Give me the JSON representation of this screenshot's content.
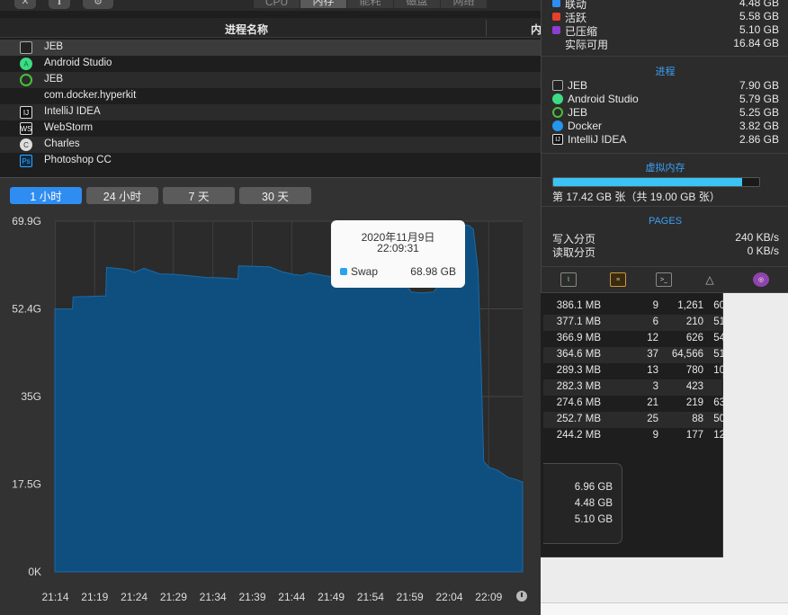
{
  "activity_monitor": {
    "toolbar": {
      "tabs": [
        "CPU",
        "内存",
        "能耗",
        "磁盘",
        "网络"
      ],
      "active_tab": 1
    },
    "columns": {
      "process_name": "进程名称",
      "memory": "内"
    },
    "processes": [
      {
        "name": "JEB",
        "icon": "jeb-icon"
      },
      {
        "name": "Android Studio",
        "icon": "android-studio-icon"
      },
      {
        "name": "JEB",
        "icon": "jeb-green-icon"
      },
      {
        "name": "com.docker.hyperkit",
        "icon": ""
      },
      {
        "name": "IntelliJ IDEA",
        "icon": "intellij-icon"
      },
      {
        "name": "WebStorm",
        "icon": "webstorm-icon"
      },
      {
        "name": "Charles",
        "icon": "charles-icon"
      },
      {
        "name": "Photoshop CC",
        "icon": "photoshop-icon"
      }
    ],
    "stats_rows": [
      {
        "mem": "386.1 MB",
        "threads": "9",
        "ports": "1,261",
        "pid": "60"
      },
      {
        "mem": "377.1 MB",
        "threads": "6",
        "ports": "210",
        "pid": "51"
      },
      {
        "mem": "366.9 MB",
        "threads": "12",
        "ports": "626",
        "pid": "54"
      },
      {
        "mem": "364.6 MB",
        "threads": "37",
        "ports": "64,566",
        "pid": "51"
      },
      {
        "mem": "289.3 MB",
        "threads": "13",
        "ports": "780",
        "pid": "10"
      },
      {
        "mem": "282.3 MB",
        "threads": "3",
        "ports": "423",
        "pid": ""
      },
      {
        "mem": "274.6 MB",
        "threads": "21",
        "ports": "219",
        "pid": "63"
      },
      {
        "mem": "252.7 MB",
        "threads": "25",
        "ports": "88",
        "pid": "50"
      },
      {
        "mem": "244.2 MB",
        "threads": "9",
        "ports": "177",
        "pid": "12"
      }
    ],
    "summary": [
      "6.96 GB",
      "4.48 GB",
      "5.10 GB"
    ]
  },
  "memory_popover": {
    "legend": [
      {
        "label": "联动",
        "value": "4.48 GB",
        "color": "#2f8cf0"
      },
      {
        "label": "活跃",
        "value": "5.58 GB",
        "color": "#e8402e"
      },
      {
        "label": "已压缩",
        "value": "5.10 GB",
        "color": "#8a3fd1"
      },
      {
        "label": "实际可用",
        "value": "16.84 GB",
        "color": ""
      }
    ],
    "processes_title": "进程",
    "apps": [
      {
        "name": "JEB",
        "value": "7.90 GB",
        "icon": "jeb-icon"
      },
      {
        "name": "Android Studio",
        "value": "5.79 GB",
        "icon": "android-studio-icon"
      },
      {
        "name": "JEB",
        "value": "5.25 GB",
        "icon": "jeb-green-icon"
      },
      {
        "name": "Docker",
        "value": "3.82 GB",
        "icon": "docker-icon"
      },
      {
        "name": "IntelliJ IDEA",
        "value": "2.86 GB",
        "icon": "intellij-icon"
      }
    ],
    "vm_title": "虚拟内存",
    "vm_fill": 0.9168,
    "vm_text": "第 17.42 GB 张（共 19.00 GB 张）",
    "pages_title": "PAGES",
    "pages": [
      {
        "label": "写入分页",
        "value": "240 KB/s"
      },
      {
        "label": "读取分页",
        "value": "0 KB/s"
      }
    ],
    "bottom_icons": [
      "activity-icon",
      "console-log-icon",
      "terminal-icon",
      "flask-icon",
      "browser-icon"
    ]
  },
  "chart_window": {
    "ranges": [
      "1 小时",
      "24 小时",
      "7 天",
      "30 天"
    ],
    "active_range": 0,
    "tooltip": {
      "date": "2020年11月9日",
      "time": "22:09:31",
      "series": "Swap",
      "value": "68.98 GB"
    }
  },
  "chart_data": {
    "type": "area",
    "series": [
      {
        "name": "Swap",
        "color": "#0f4f7f",
        "points": [
          [
            0,
            52.4
          ],
          [
            0.5,
            52.4
          ],
          [
            1.1,
            52.4
          ],
          [
            1.15,
            54.8
          ],
          [
            3.2,
            55.0
          ],
          [
            3.25,
            60.7
          ],
          [
            4.5,
            60.3
          ],
          [
            5.0,
            59.7
          ],
          [
            5.6,
            60.5
          ],
          [
            6.6,
            59.4
          ],
          [
            7.5,
            59.3
          ],
          [
            8.5,
            59.0
          ],
          [
            9.5,
            58.7
          ],
          [
            10.5,
            58.6
          ],
          [
            11.5,
            58.4
          ],
          [
            11.55,
            61.0
          ],
          [
            13.5,
            60.8
          ],
          [
            14.3,
            59.8
          ],
          [
            15.0,
            59.3
          ],
          [
            15.5,
            59.1
          ],
          [
            16.0,
            59.6
          ],
          [
            17.0,
            59.0
          ],
          [
            18.0,
            58.6
          ],
          [
            19.0,
            58.5
          ],
          [
            20.0,
            58.2
          ],
          [
            21.0,
            57.8
          ],
          [
            22.0,
            57.4
          ],
          [
            22.4,
            55.8
          ],
          [
            23.0,
            55.6
          ],
          [
            23.8,
            55.8
          ],
          [
            24.2,
            57.5
          ],
          [
            24.8,
            59.0
          ],
          [
            25.0,
            62.0
          ],
          [
            25.15,
            67.5
          ],
          [
            25.3,
            69.2
          ],
          [
            26.0,
            69.1
          ],
          [
            26.3,
            68.3
          ],
          [
            26.6,
            60.0
          ],
          [
            26.8,
            40.0
          ],
          [
            26.95,
            22.0
          ],
          [
            27.3,
            20.8
          ],
          [
            27.8,
            20.3
          ],
          [
            28.5,
            18.8
          ],
          [
            29.0,
            18.4
          ],
          [
            29.4,
            17.9
          ]
        ]
      }
    ],
    "x_labels": [
      "21:14",
      "21:19",
      "21:24",
      "21:29",
      "21:34",
      "21:39",
      "21:44",
      "21:49",
      "21:54",
      "21:59",
      "22:04",
      "22:09"
    ],
    "x_range_minutes": [
      0,
      29.4
    ],
    "y_labels": [
      "69.9G",
      "52.4G",
      "35G",
      "17.5G",
      "0K"
    ],
    "ylim": [
      0,
      69.9
    ],
    "grid": true
  }
}
